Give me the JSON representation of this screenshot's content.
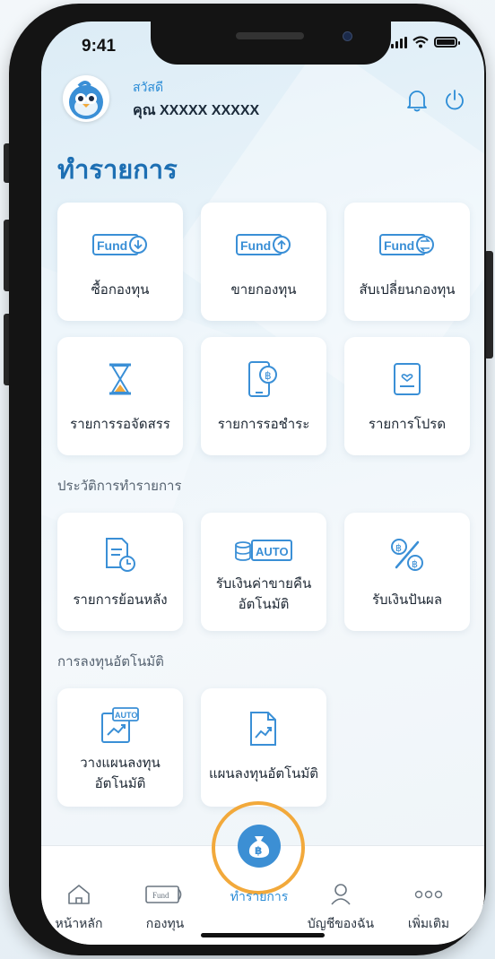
{
  "status_bar": {
    "time": "9:41"
  },
  "header": {
    "greeting": "สวัสดี",
    "user_name": "คุณ XXXXX XXXXX"
  },
  "page_title": "ทำรายการ",
  "tiles_main": [
    {
      "label": "ซื้อกองทุน",
      "icon": "fund-buy-icon"
    },
    {
      "label": "ขายกองทุน",
      "icon": "fund-sell-icon"
    },
    {
      "label": "สับเปลี่ยนกองทุน",
      "icon": "fund-switch-icon"
    },
    {
      "label": "รายการรอจัดสรร",
      "icon": "hourglass-icon"
    },
    {
      "label": "รายการรอชำระ",
      "icon": "mobile-payment-icon"
    },
    {
      "label": "รายการโปรด",
      "icon": "favorite-list-icon"
    }
  ],
  "section_history": "ประวัติการทำรายการ",
  "tiles_history": [
    {
      "label": "รายการย้อนหลัง",
      "icon": "history-document-icon"
    },
    {
      "label_line1": "รับเงินค่าขายคืน",
      "label_line2": "อัตโนมัติ",
      "badge": "AUTO",
      "icon": "auto-redemption-icon"
    },
    {
      "label": "รับเงินปันผล",
      "icon": "dividend-percent-icon"
    }
  ],
  "section_auto": "การลงทุนอัตโนมัติ",
  "tiles_auto": [
    {
      "label_line1": "วางแผนลงทุน",
      "label_line2": "อัตโนมัติ",
      "badge": "AUTO",
      "icon": "auto-invest-plan-icon"
    },
    {
      "label": "แผนลงทุนอัตโนมัติ",
      "icon": "invest-plan-document-icon"
    }
  ],
  "nav": {
    "home": "หน้าหลัก",
    "funds": "กองทุน",
    "funds_card_text": "Fund",
    "transactions": "ทำรายการ",
    "account": "บัญชีของฉัน",
    "more": "เพิ่มเติม"
  },
  "icon_text": {
    "fund": "Fund"
  },
  "colors": {
    "primary": "#1d6fb3",
    "accent_blue": "#3c8fd4",
    "highlight_ring": "#f2a93b"
  }
}
